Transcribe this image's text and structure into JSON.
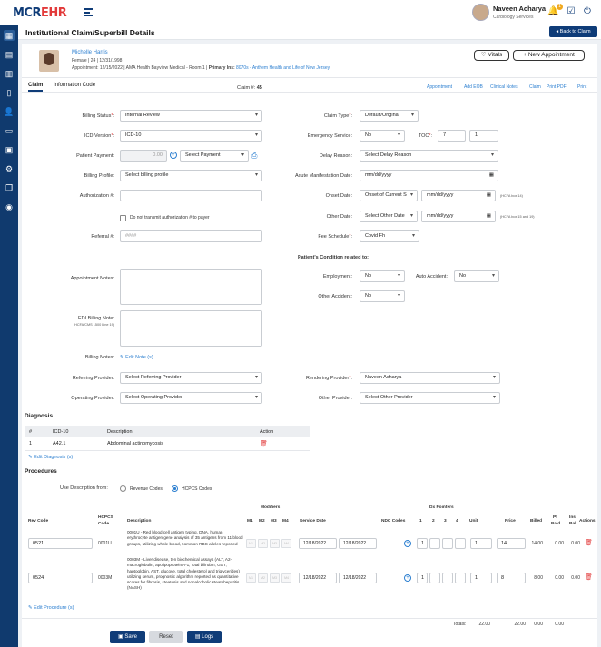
{
  "app": {
    "logo_text": "MCR",
    "logo_text2": "EHR"
  },
  "user": {
    "name": "Naveen Acharya",
    "role": "Cardiology Services",
    "notif_count": "1"
  },
  "header": {
    "title": "Institutional Claim/Superbill Details",
    "back_label": "Back to Claim"
  },
  "patient": {
    "name": "Michelle Harris",
    "info": "Female | 24 | 12/31/1998",
    "appointment": "Appointment: 12/15/2022 | AMA Health Bayview Medical - Room 1 |",
    "primary_ins_label": "Primary Ins:",
    "primary_ins": "8070s - Anthem Health and Life of New Jersey",
    "vitals_label": "Vitals",
    "new_appt_label": "+ New Appointment"
  },
  "tabs": [
    {
      "label": "Claim"
    },
    {
      "label": "Information Code"
    }
  ],
  "claim_no_label": "Claim #:",
  "claim_no": "45",
  "actions": [
    "Appointment",
    "Add EOB",
    "Clinical Notes",
    "Claim",
    "Print PDF",
    "Print"
  ],
  "form": {
    "billing_status": {
      "label": "Billing Status",
      "value": "Internal Review"
    },
    "icd_version": {
      "label": "ICD Version",
      "value": "ICD-10"
    },
    "patient_payment": {
      "label": "Patient Payment:",
      "value": "0.00",
      "select": "Select Payment"
    },
    "billing_profile": {
      "label": "Billing Profile:",
      "value": "Select billing profile"
    },
    "authorization": {
      "label": "Authorization #:",
      "value": ""
    },
    "no_transmit": {
      "label": "Do not transmit authorization # to payer"
    },
    "referral": {
      "label": "Referral #:",
      "placeholder": "####"
    },
    "appointment_notes": {
      "label": "Appointment Notes:"
    },
    "edi_billing_note": {
      "label": "EDI Billing Note:",
      "hint": "(HCFA/CMS 1500 Line 19)"
    },
    "billing_notes": {
      "label": "Billing Notes:",
      "link": "Edit Note (s)"
    },
    "referring_provider": {
      "label": "Referring Provider:",
      "value": "Select Referring Provider"
    },
    "operating_provider": {
      "label": "Operating Provider:",
      "value": "Select Operating Provider"
    },
    "claim_type": {
      "label": "Claim Type",
      "value": "Default/Original"
    },
    "emergency_service": {
      "label": "Emergency Service:",
      "value": "No"
    },
    "toc": {
      "label": "TOC",
      "value1": "7",
      "value2": "1"
    },
    "delay_reason": {
      "label": "Delay Reason:",
      "value": "Select Delay Reason"
    },
    "acute_manifestation": {
      "label": "Acute Manifestation Date:",
      "value": "mm/dd/yyyy"
    },
    "onset_date": {
      "label": "Onset Date:",
      "value": "Onset of Current S",
      "date": "mm/dd/yyyy",
      "hint": "(HCFA box 14)"
    },
    "other_date": {
      "label": "Other Date:",
      "value": "Select Other Date",
      "date": "mm/dd/yyyy",
      "hint": "(HCFA box 15 and 19)"
    },
    "fee_schedule": {
      "label": "Fee Schedule",
      "value": "Covid Fh"
    },
    "condition_title": "Patient's Condition related to:",
    "employment": {
      "label": "Employment:",
      "value": "No"
    },
    "auto_accident": {
      "label": "Auto Accident:",
      "value": "No"
    },
    "other_accident": {
      "label": "Other Accident:",
      "value": "No"
    },
    "rendering_provider": {
      "label": "Rendering Provider",
      "value": "Naveen Acharya"
    },
    "other_provider": {
      "label": "Other Provider:",
      "value": "Select Other Provider"
    }
  },
  "diagnosis": {
    "title": "Diagnosis",
    "headers": [
      "#",
      "ICD-10",
      "Description",
      "Action"
    ],
    "rows": [
      {
        "num": "1",
        "code": "A42.1",
        "desc": "Abdominal actinomycosis"
      }
    ],
    "edit_link": "Edit Diagnosis (s)"
  },
  "procedures": {
    "title": "Procedures",
    "use_desc_label": "Use Description from:",
    "opt_revenue": "Revenue Codes",
    "opt_hcpcs": "HCPCS Codes",
    "modifiers_title": "Modifiers",
    "dx_title": "Dx Pointers",
    "headers": {
      "rev": "Rev Code",
      "hcpcs": "HCPCS",
      "hcpcs2": "Code",
      "desc": "Description",
      "m1": "M1",
      "m2": "M2",
      "m3": "M3",
      "m4": "M4",
      "service": "Service Date",
      "ndc": "NDC Codes",
      "d1": "1",
      "d2": "2",
      "d3": "3",
      "d4": "4",
      "unit": "Unit",
      "price": "Price",
      "billed": "Billed",
      "pt1": "Pt",
      "pt2": "Paid",
      "ins1": "Ins",
      "ins2": "Bal",
      "actions": "Actions"
    },
    "mod_placeholders": [
      "M1",
      "M2",
      "M3",
      "M4"
    ],
    "rows": [
      {
        "rev": "0521",
        "hcpcs": "0001U",
        "desc": "0001U - Red blood cell antigen typing, DNA, human erythrocyte antigen gene analysis of 35 antigens from 11 blood groups, utilizing whole blood, common RBC alleles reported",
        "date_from": "12/18/2022",
        "date_to": "12/18/2022",
        "dx1": "1",
        "unit": "1",
        "price": "14",
        "billed": "14.00",
        "pt_paid": "0.00",
        "ins_bal": "0.00"
      },
      {
        "rev": "0524",
        "hcpcs": "0003M",
        "desc": "0003M - Liver disease, ten biochemical assays (ALT, A2-macroglobulin, apolipoprotein A-1, total bilirubin, GGT, haptoglobin, AST, glucose, total cholesterol and triglycerides) utilizing serum, prognostic algorithm reported as quantitative scores for fibrosis, steatosis and nonalcoholic steatohepatitis (NASH)",
        "date_from": "12/18/2022",
        "date_to": "12/18/2022",
        "dx1": "1",
        "unit": "1",
        "price": "8",
        "billed": "8.00",
        "pt_paid": "0.00",
        "ins_bal": "0.00"
      }
    ],
    "edit_link": "Edit Procedure (s)",
    "totals": {
      "label": "Totals:",
      "unit": "22.00",
      "price": "22.00",
      "billed": "0.00",
      "pt": "0.00"
    }
  },
  "footer": {
    "save": "Save",
    "reset": "Reset",
    "logs": "Logs"
  }
}
